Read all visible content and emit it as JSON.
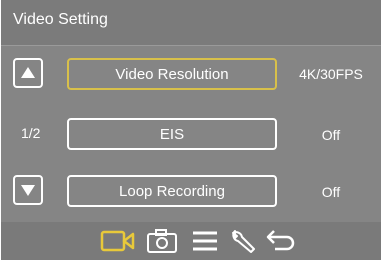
{
  "header": {
    "title": "Video Setting"
  },
  "pager": {
    "indicator": "1/2"
  },
  "settings": [
    {
      "label": "Video Resolution",
      "value": "4K/30FPS",
      "selected": true
    },
    {
      "label": "EIS",
      "value": "Off",
      "selected": false
    },
    {
      "label": "Loop Recording",
      "value": "Off",
      "selected": false
    }
  ],
  "toolbar": {
    "icons": [
      "video-camera-icon",
      "camera-icon",
      "menu-icon",
      "wrench-icon",
      "back-icon"
    ],
    "active": "video-camera-icon",
    "active_color": "#e8c93a"
  },
  "colors": {
    "background": "#858585",
    "highlight": "#d8c04a"
  }
}
